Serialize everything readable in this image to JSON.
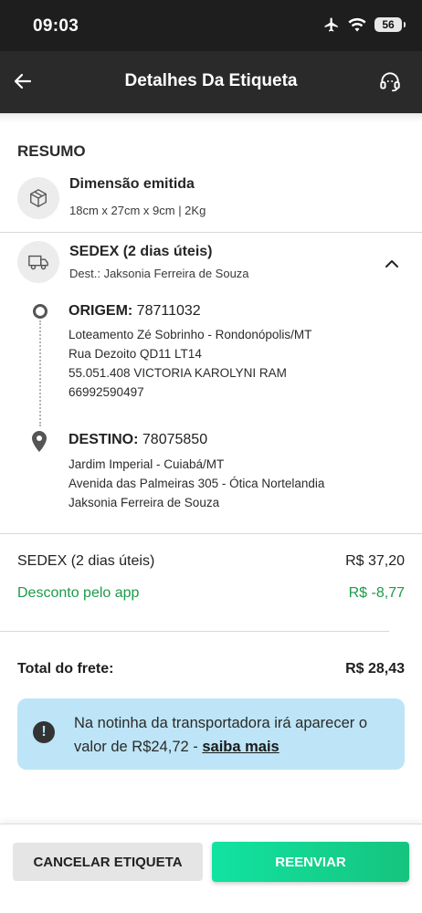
{
  "status_bar": {
    "time": "09:03",
    "battery": "56"
  },
  "header": {
    "title": "Detalhes Da Etiqueta",
    "back_icon": "arrow-left-icon",
    "support_icon": "headset-icon"
  },
  "summary": {
    "title": "RESUMO",
    "dimension": {
      "title": "Dimensão emitida",
      "value": "18cm x 27cm x 9cm | 2Kg",
      "icon": "package-icon"
    },
    "shipping": {
      "title": "SEDEX (2 dias úteis)",
      "dest": "Dest.: Jaksonia Ferreira de Souza",
      "icon": "truck-icon"
    }
  },
  "origin": {
    "label": "ORIGEM:",
    "cep": "78711032",
    "lines": [
      "Loteamento Zé Sobrinho - Rondonópolis/MT",
      "Rua Dezoito QD11 LT14",
      "55.051.408 VICTORIA KAROLYNI RAM",
      "66992590497"
    ]
  },
  "destination": {
    "label": "DESTINO:",
    "cep": "78075850",
    "lines": [
      "Jardim Imperial - Cuiabá/MT",
      "Avenida das Palmeiras 305 - Ótica Nortelandia",
      "Jaksonia Ferreira de Souza"
    ]
  },
  "prices": {
    "service_label": "SEDEX (2 dias úteis)",
    "service_value": "R$ 37,20",
    "discount_label": "Desconto pelo app",
    "discount_value": "R$ -8,77",
    "total_label": "Total do frete:",
    "total_value": "R$ 28,43"
  },
  "info": {
    "text": "Na notinha da transportadora irá aparecer o valor de R$24,72 - ",
    "link": "saiba mais"
  },
  "actions": {
    "cancel": "CANCELAR ETIQUETA",
    "resend": "REENVIAR"
  },
  "colors": {
    "accent": "#15c47e",
    "discount": "#1e9a4a",
    "info_bg": "#bde5f7"
  }
}
